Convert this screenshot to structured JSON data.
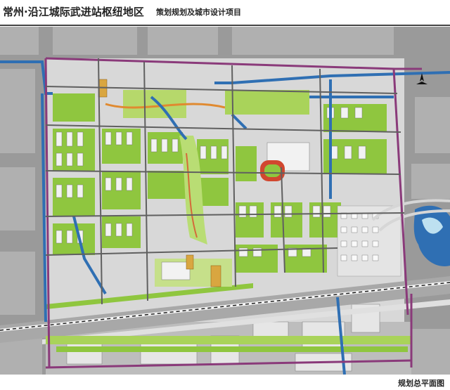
{
  "header": {
    "title": "常州·沿江城际武进站枢纽地区",
    "subtitle": "策划规划及城市设计项目"
  },
  "footer": {
    "caption": "规划总平面图"
  },
  "colors": {
    "background": "#9a9a9a",
    "blocks_gray": "#b4b4b4",
    "green_space": "#8fc63f",
    "light_green": "#c6e08a",
    "water": "#2f6fb3",
    "main_road": "#8a3a7a",
    "building_white": "#f2f2f2",
    "railway": "#e8e8e8"
  },
  "icons": {
    "compass": "north-arrow-icon"
  }
}
